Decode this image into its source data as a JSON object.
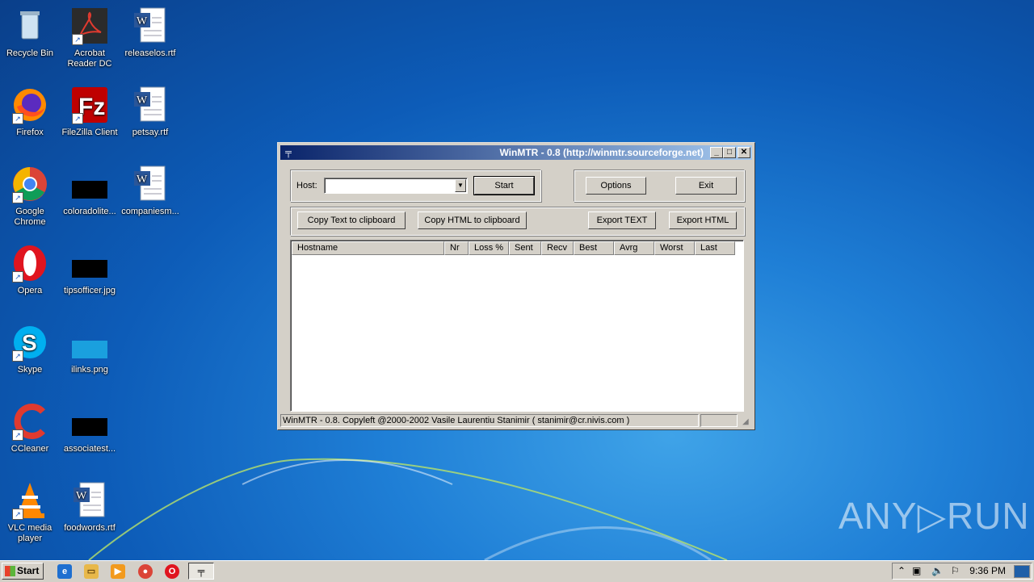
{
  "desktop": {
    "icons": [
      {
        "label": "Recycle Bin"
      },
      {
        "label": "Acrobat Reader DC"
      },
      {
        "label": "releaselos.rtf"
      },
      {
        "label": "Firefox"
      },
      {
        "label": "FileZilla Client"
      },
      {
        "label": "petsay.rtf"
      },
      {
        "label": "Google Chrome"
      },
      {
        "label": "coloradolite..."
      },
      {
        "label": "companiesm..."
      },
      {
        "label": "Opera"
      },
      {
        "label": "tipsofficer.jpg"
      },
      {
        "label": "Skype"
      },
      {
        "label": "ilinks.png"
      },
      {
        "label": "CCleaner"
      },
      {
        "label": "associatest..."
      },
      {
        "label": "VLC media player"
      },
      {
        "label": "foodwords.rtf"
      }
    ]
  },
  "window": {
    "title": "WinMTR - 0.8 (http://winmtr.sourceforge.net)",
    "minimize": "_",
    "maximize": "□",
    "close": "✕",
    "host_label": "Host:",
    "host_value": "",
    "start_label": "Start",
    "options_label": "Options",
    "exit_label": "Exit",
    "copy_text_label": "Copy Text to clipboard",
    "copy_html_label": "Copy HTML to clipboard",
    "export_text_label": "Export TEXT",
    "export_html_label": "Export HTML",
    "columns": [
      "Hostname",
      "Nr",
      "Loss %",
      "Sent",
      "Recv",
      "Best",
      "Avrg",
      "Worst",
      "Last"
    ],
    "status_text": "WinMTR - 0.8. Copyleft @2000-2002 Vasile Laurentiu Stanimir  ( stanimir@cr.nivis.com )"
  },
  "taskbar": {
    "start_label": "Start",
    "clock": "9:36 PM"
  },
  "watermark": "ANY▷RUN"
}
